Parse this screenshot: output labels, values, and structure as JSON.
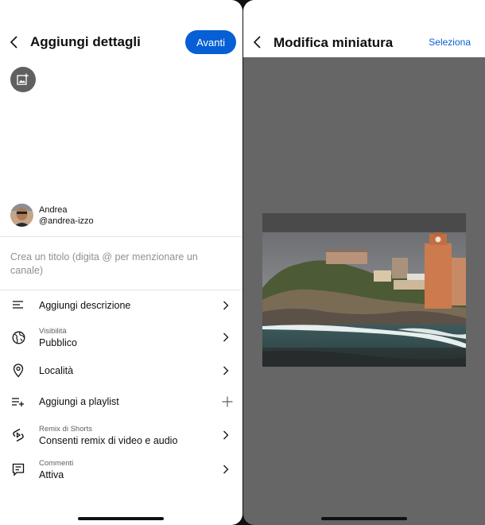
{
  "left": {
    "header": {
      "title": "Aggiungi dettagli",
      "next_label": "Avanti"
    },
    "user": {
      "name": "Andrea",
      "handle": "@andrea-izzo"
    },
    "title_placeholder": "Crea un titolo (digita @ per menzionare un canale)",
    "rows": [
      {
        "label": "Aggiungi descrizione",
        "sub": "",
        "icon": "description-icon",
        "action": "chevron"
      },
      {
        "label": "Pubblico",
        "sub": "Visibilità",
        "icon": "globe-icon",
        "action": "chevron"
      },
      {
        "label": "Località",
        "sub": "",
        "icon": "location-pin-icon",
        "action": "chevron"
      },
      {
        "label": "Aggiungi a playlist",
        "sub": "",
        "icon": "playlist-add-icon",
        "action": "plus"
      },
      {
        "label": "Consenti remix di video e audio",
        "sub": "Remix di Shorts",
        "icon": "remix-icon",
        "action": "chevron"
      },
      {
        "label": "Attiva",
        "sub": "Commenti",
        "icon": "comment-icon",
        "action": "chevron"
      }
    ]
  },
  "right": {
    "header": {
      "title": "Modifica miniatura",
      "select_label": "Seleziona"
    }
  },
  "colors": {
    "accent": "#065fd4",
    "overlay": "#666666"
  }
}
